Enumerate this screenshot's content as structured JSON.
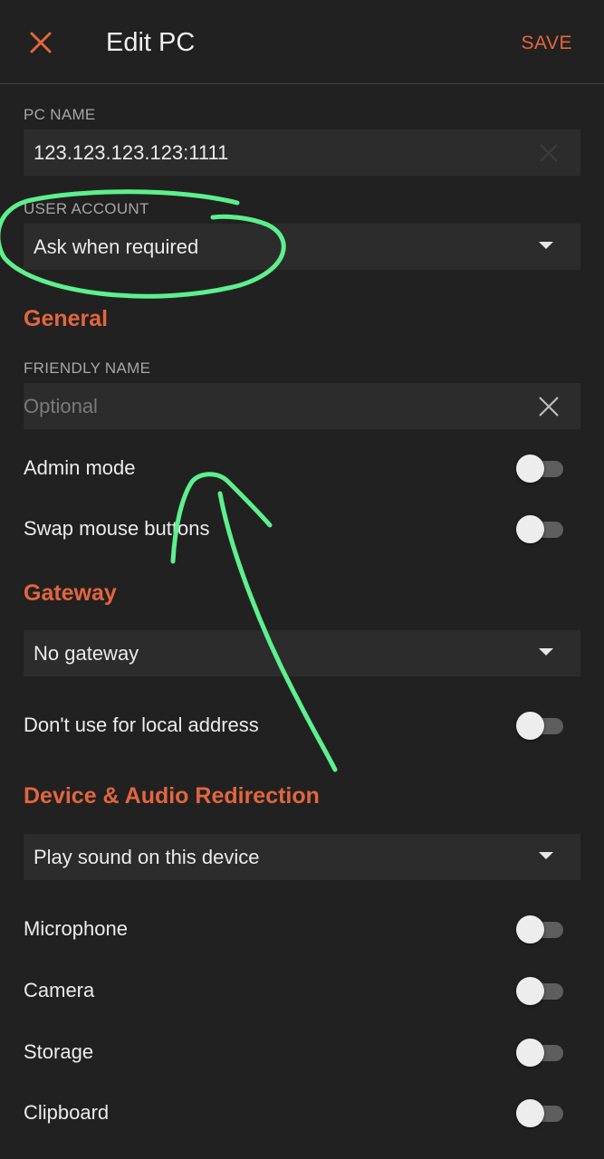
{
  "appbar": {
    "title": "Edit PC",
    "save_label": "SAVE",
    "close_icon": "close-icon"
  },
  "pc_name": {
    "label": "PC NAME",
    "value": "123.123.123.123:1111"
  },
  "user_account": {
    "label": "USER ACCOUNT",
    "selected": "Ask when required"
  },
  "general": {
    "title": "General",
    "friendly_name": {
      "label": "FRIENDLY NAME",
      "value": "",
      "placeholder": "Optional"
    },
    "toggles": [
      {
        "label": "Admin mode",
        "on": false
      },
      {
        "label": "Swap mouse buttons",
        "on": false
      }
    ]
  },
  "gateway": {
    "title": "Gateway",
    "selected": "No gateway",
    "toggles": [
      {
        "label": "Don't use for local address",
        "on": false
      }
    ]
  },
  "device_audio": {
    "title": "Device & Audio Redirection",
    "selected": "Play sound on this device",
    "toggles": [
      {
        "label": "Microphone",
        "on": false
      },
      {
        "label": "Camera",
        "on": false
      },
      {
        "label": "Storage",
        "on": false
      },
      {
        "label": "Clipboard",
        "on": false
      }
    ]
  },
  "colors": {
    "background": "#212121",
    "field_background": "#2c2c2c",
    "accent": "#e2663e",
    "annotation": "#5df08e"
  }
}
